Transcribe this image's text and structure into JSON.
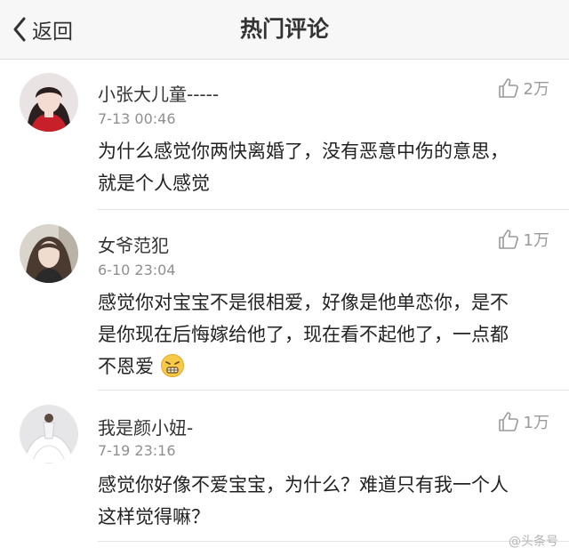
{
  "nav": {
    "back_label": "返回",
    "title": "热门评论"
  },
  "comments": [
    {
      "username": "小张大儿童-----",
      "time": "7-13 00:46",
      "likes": "2万",
      "lines": [
        "为什么感觉你两快离婚了，没有恶意中伤的意思，",
        "就是个人感觉"
      ]
    },
    {
      "username": "女爷范犯",
      "time": "6-10 23:04",
      "likes": "1万",
      "lines": [
        "感觉你对宝宝不是很相爱，好像是他单恋你，是不",
        "是你现在后悔嫁给他了，现在看不起他了，一点都",
        "不恩爱"
      ]
    },
    {
      "username": "我是颜小妞-",
      "time": "7-19 23:16",
      "likes": "1万",
      "lines": [
        "感觉你好像不爱宝宝，为什么？难道只有我一个人",
        "这样觉得嘛？"
      ]
    }
  ],
  "watermark": "@头条号",
  "icons": {
    "back": "chevron-left-icon",
    "like": "thumbs-up-icon",
    "emoji": "grimace-emoji-icon"
  },
  "colors": {
    "nav_bg": "#f7f7f7",
    "text": "#222222",
    "meta": "#8f8f8f"
  }
}
